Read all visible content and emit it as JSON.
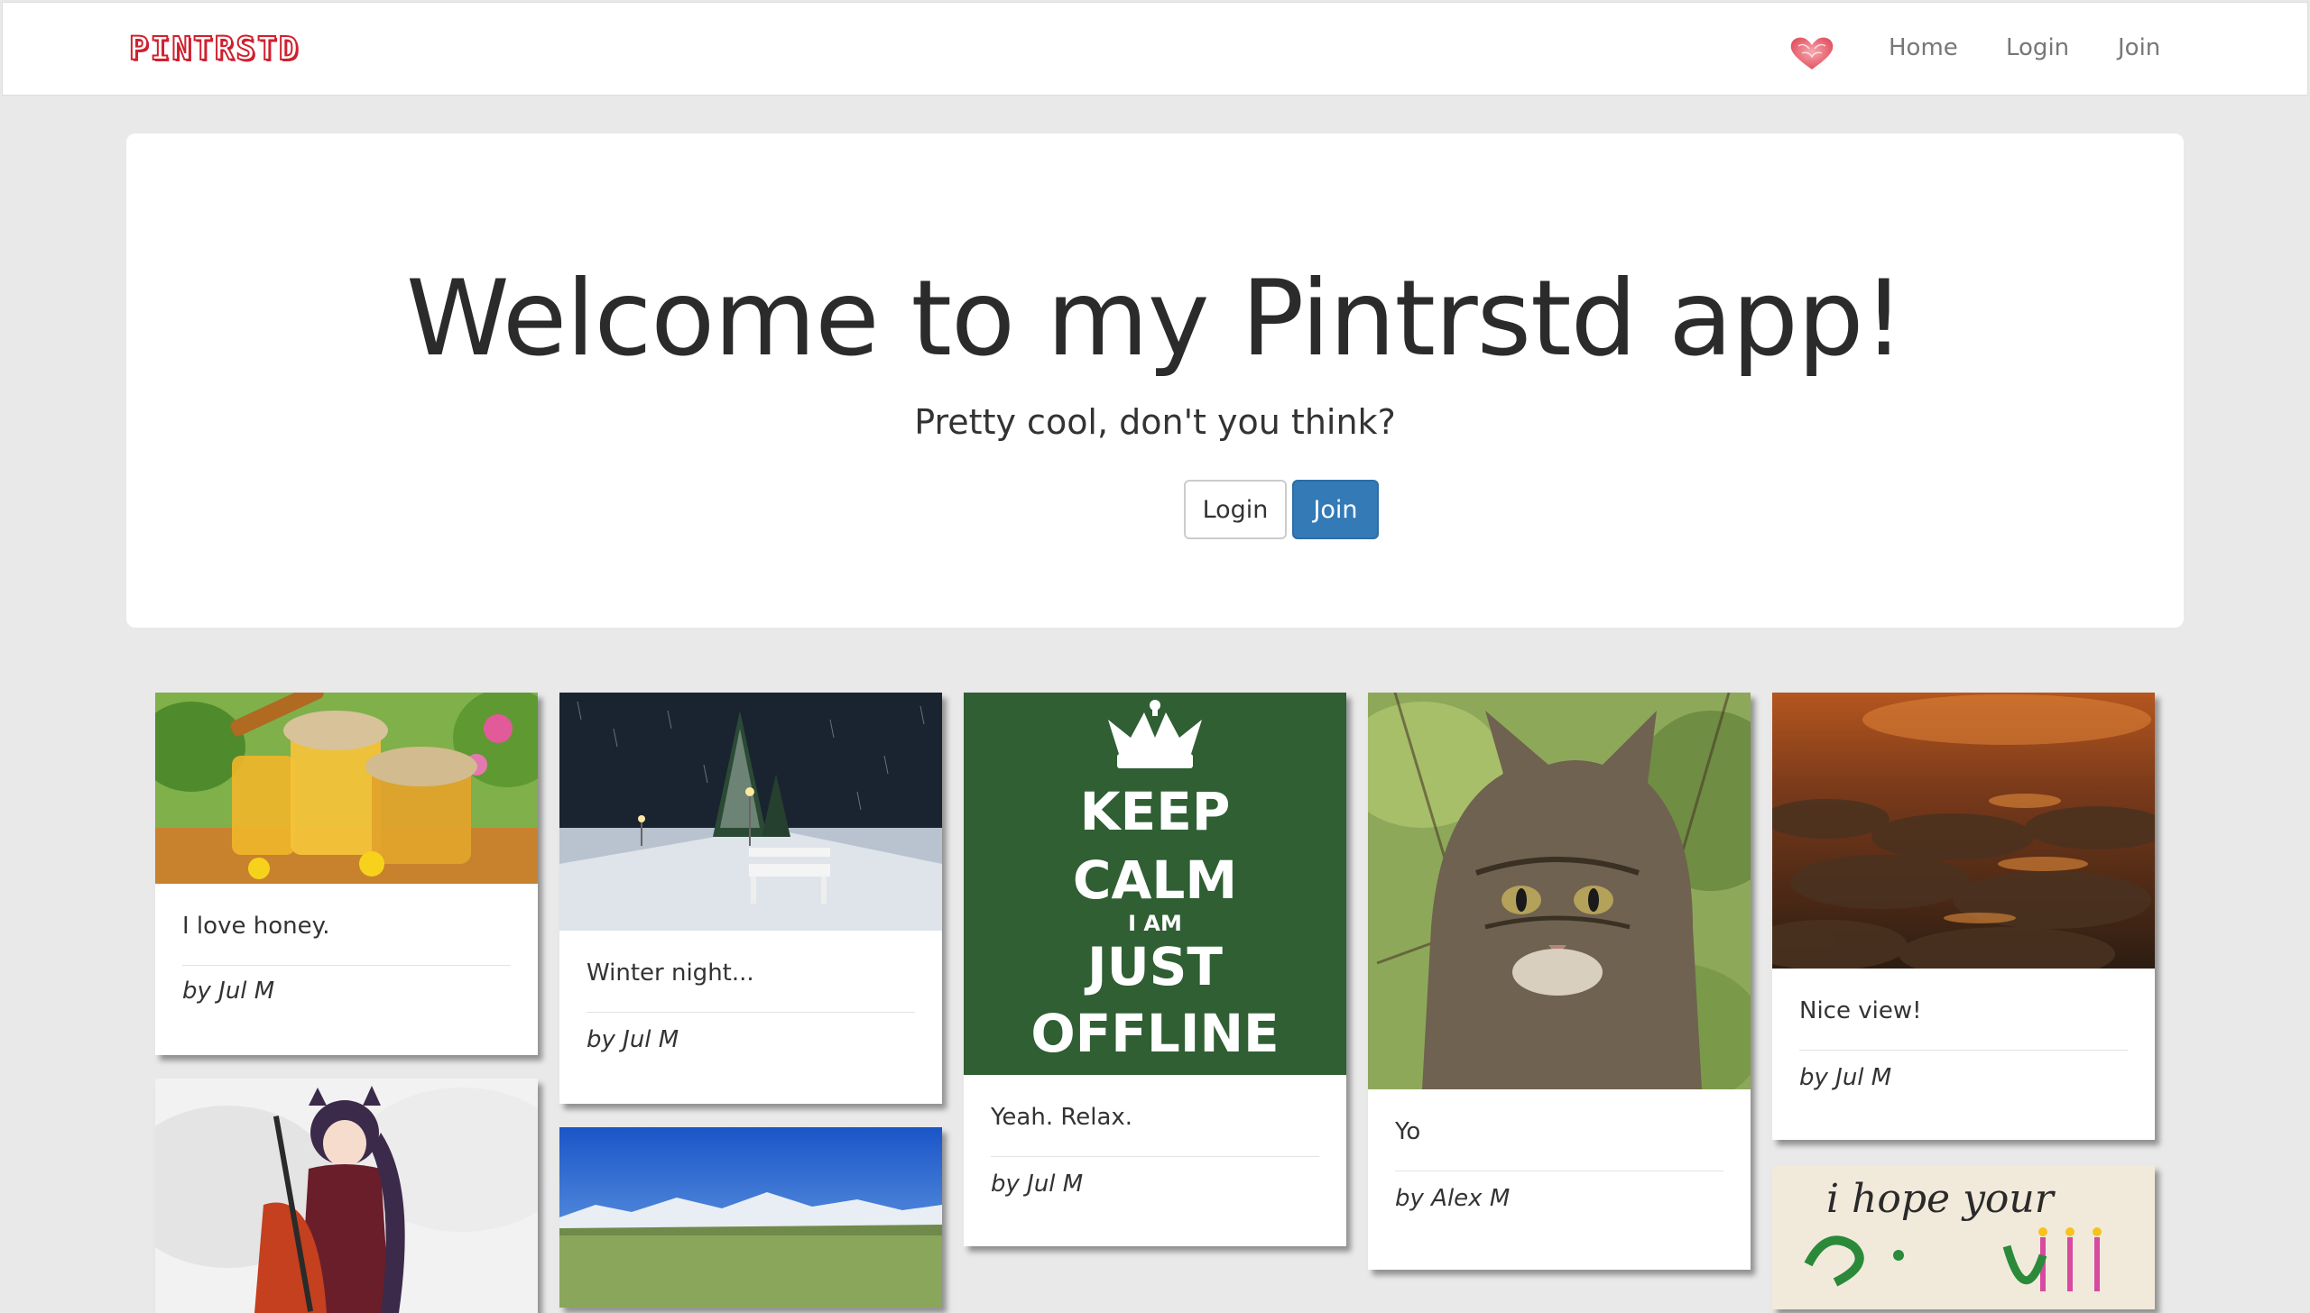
{
  "navbar": {
    "brand": "PINTRSTD",
    "links": {
      "home": "Home",
      "login": "Login",
      "join": "Join"
    }
  },
  "hero": {
    "title": "Welcome to my Pintrstd app!",
    "subtitle": "Pretty cool, don't you think?",
    "login_label": "Login",
    "join_label": "Join"
  },
  "pins": [
    {
      "description": "I love honey.",
      "author": "by Jul M",
      "image": "honey-jars"
    },
    {
      "description": "Winter night...",
      "author": "by Jul M",
      "image": "snowy-street-night"
    },
    {
      "description": "Yeah. Relax.",
      "author": "by Jul M",
      "image": "keep-calm-poster",
      "poster": {
        "line1": "KEEP",
        "line2": "CALM",
        "line3": "I AM",
        "line4": "JUST",
        "line5": "OFFLINE",
        "color": "#2f5f33"
      }
    },
    {
      "description": "Yo",
      "author": "by Alex M",
      "image": "tabby-cat"
    },
    {
      "description": "Nice view!",
      "author": "by Jul M",
      "image": "sunset-above-clouds"
    },
    {
      "image": "anime-warrior-girl"
    },
    {
      "image": "mountain-landscape"
    },
    {
      "image": "handwritten-card",
      "card_text": "i hope your"
    }
  ],
  "colors": {
    "background": "#e9e9e9",
    "brand": "#d0202e",
    "primary": "#337ab7"
  }
}
